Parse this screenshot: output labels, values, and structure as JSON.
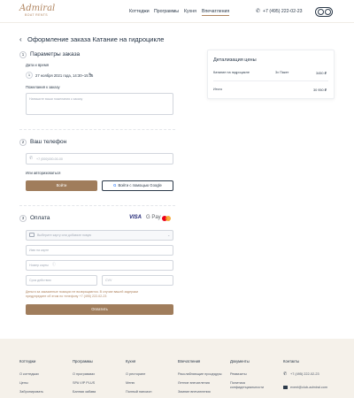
{
  "header": {
    "logo": "Admiral",
    "logo_sub": "BOAT RENTS",
    "nav": [
      "Коттеджи",
      "Программы",
      "Кухня",
      "Впечатления"
    ],
    "phone": "+7 (495) 222-02-23"
  },
  "page": {
    "back": "‹",
    "title": "Оформление заказа Катание на гидроцикле"
  },
  "section1": {
    "number": "1",
    "title": "Параметры заказа",
    "date_label": "Дата и время",
    "date_count": "1",
    "date_value": "27 ноября 2021 года, 14:30–15:15",
    "wishes_label": "Пожелания к заказу",
    "wishes_placeholder": "Напишите ваши пожелания к заказу"
  },
  "section2": {
    "number": "2",
    "title": "Ваш телефон",
    "phone_placeholder": "+7 (000)000-00-00",
    "or_login": "Или авторизоваться",
    "login_button": "Войти",
    "google_button": "Войти с помощью Google"
  },
  "section3": {
    "number": "3",
    "title": "Оплата",
    "payment_methods": [
      "VISA",
      "G Pay"
    ],
    "card_select_placeholder": "Выберите карту или добавьте новую",
    "card_name_placeholder": "Имя на карте",
    "card_number_placeholder": "Номер карты",
    "expiry_placeholder": "Срок действия",
    "cvv_placeholder": "CVV",
    "notice": "Деньги за заказанные позиции не возвращаются. В случае вашей задержки предупредите об этом по телефону",
    "notice_phone": "+7 (495) 222-02-23",
    "pay_button": "Оплатить"
  },
  "price_card": {
    "title": "Детализация цены",
    "item_name": "Катание на гидроцикле",
    "item_duration": "3x Пакет",
    "item_price": "3450 ₽",
    "total_label": "Итого",
    "total_value": "30 950 ₽"
  },
  "footer": {
    "columns": [
      {
        "title": "Коттеджи",
        "items": [
          "О коттеджах",
          "Цены",
          "Забронировать"
        ]
      },
      {
        "title": "Программы",
        "items": [
          "О программах",
          "SPA VIP PLUS",
          "Банная забава"
        ]
      },
      {
        "title": "Кухня",
        "items": [
          "О ресторане",
          "Меню",
          "Полный пансион"
        ]
      },
      {
        "title": "Впечатления",
        "items": [
          "Расслабляющие процедуры",
          "Летние впечатления",
          "Зимние впечатления"
        ]
      },
      {
        "title": "Документы",
        "items": [
          "Реквизиты",
          "Политика конфиденциальности"
        ]
      },
      {
        "title": "Контакты",
        "items": [
          "+7 (495) 222-02-23",
          "event@club-admiral.com"
        ]
      }
    ]
  },
  "colors": {
    "accent": "#a07d5c",
    "text": "#1f2e40",
    "footer_bg": "#f5f1ea"
  }
}
